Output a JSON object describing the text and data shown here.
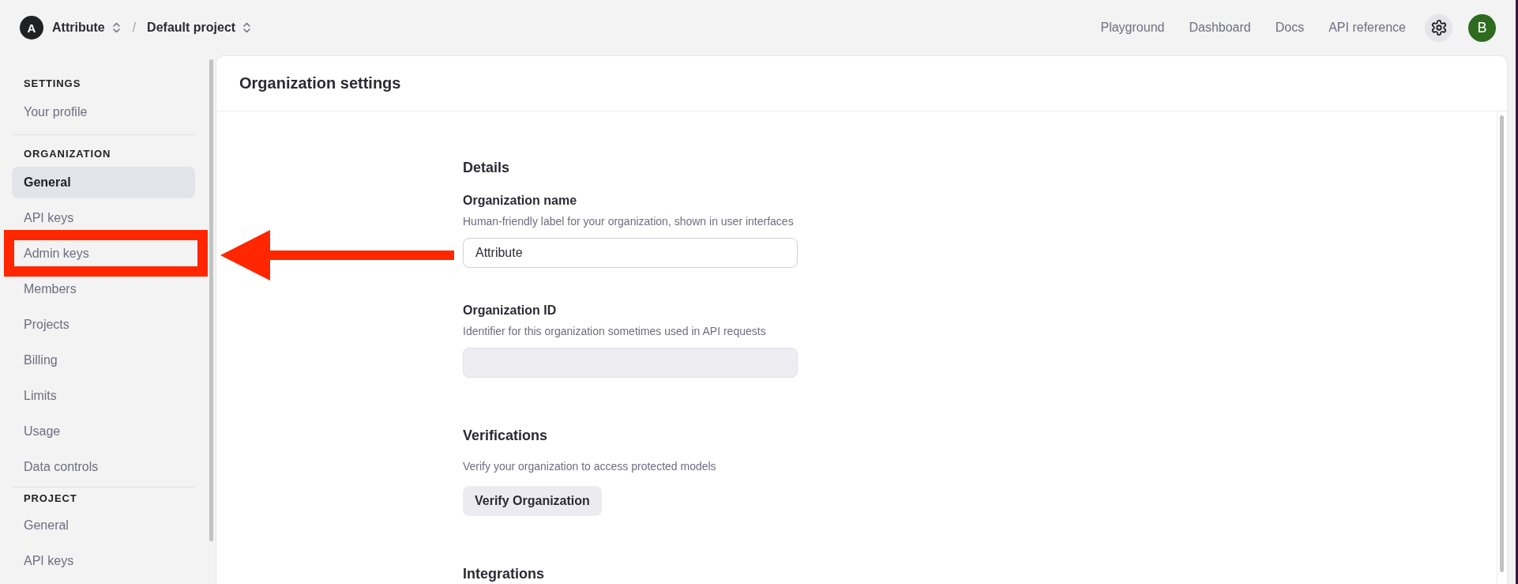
{
  "top_bar": {
    "organization": {
      "avatar": "A",
      "name": "Attribute"
    },
    "separator": "/",
    "project": "Default project",
    "links": [
      "Playground",
      "Dashboard",
      "Docs",
      "API reference"
    ],
    "user_avatar": "B"
  },
  "sidebar": {
    "sections": [
      {
        "heading": "SETTINGS",
        "items": [
          {
            "label": "Your profile",
            "selected": false,
            "highlighted": false
          }
        ]
      },
      {
        "heading": "ORGANIZATION",
        "items": [
          {
            "label": "General",
            "selected": true,
            "highlighted": false
          },
          {
            "label": "API keys",
            "selected": false,
            "highlighted": false
          },
          {
            "label": "Admin keys",
            "selected": false,
            "highlighted": true
          },
          {
            "label": "Members",
            "selected": false,
            "highlighted": false
          },
          {
            "label": "Projects",
            "selected": false,
            "highlighted": false
          },
          {
            "label": "Billing",
            "selected": false,
            "highlighted": false
          },
          {
            "label": "Limits",
            "selected": false,
            "highlighted": false
          },
          {
            "label": "Usage",
            "selected": false,
            "highlighted": false
          },
          {
            "label": "Data controls",
            "selected": false,
            "highlighted": false
          }
        ]
      },
      {
        "heading": "PROJECT",
        "items": [
          {
            "label": "General",
            "selected": false,
            "highlighted": false
          },
          {
            "label": "API keys",
            "selected": false,
            "highlighted": false
          }
        ]
      }
    ]
  },
  "page": {
    "title": "Organization settings",
    "sections": [
      {
        "heading": "Details",
        "fields": [
          {
            "label": "Organization name",
            "hint": "Human-friendly label for your organization, shown in user interfaces",
            "value": "Attribute",
            "disabled": false
          },
          {
            "label": "Organization ID",
            "hint": "Identifier for this organization sometimes used in API requests",
            "disabled": true
          }
        ]
      },
      {
        "heading": "Verifications",
        "description": "Verify your organization to access protected models",
        "button": "Verify Organization"
      },
      {
        "heading": "Integrations"
      }
    ]
  }
}
